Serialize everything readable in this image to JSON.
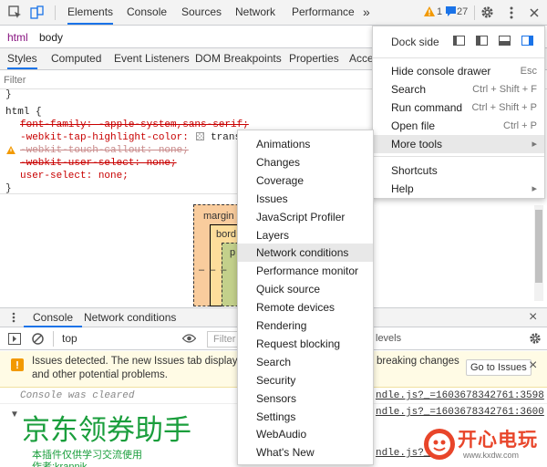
{
  "toolbar": {
    "tabs": [
      "Elements",
      "Console",
      "Sources",
      "Network",
      "Performance"
    ],
    "more_label": "»",
    "warning_count": "1",
    "message_count": "27"
  },
  "breadcrumb": [
    "html",
    "body"
  ],
  "subtabs": [
    "Styles",
    "Computed",
    "Event Listeners",
    "DOM Breakpoints",
    "Properties",
    "Acce"
  ],
  "filter": {
    "placeholder": "Filter"
  },
  "styles": {
    "brace_close_top": "}",
    "selector": "html {",
    "rules": [
      {
        "text": "font-family: -apple-system,sans-serif;",
        "struck": true
      },
      {
        "text": "-webkit-tap-highlight-color:",
        "value": "transpare",
        "struck": false,
        "swatch": true
      },
      {
        "text": "-webkit-touch-callout: none;",
        "struck": true,
        "warning": true
      },
      {
        "text": "-webkit-user-select: none;",
        "struck": true
      },
      {
        "text": "user-select: none;",
        "struck": false
      }
    ],
    "brace_close": "}"
  },
  "box_model": {
    "margin_label": "margin",
    "border_label": "bord",
    "padding_label": "p",
    "dash": "–"
  },
  "drawer": {
    "tabs": [
      "Console",
      "Network conditions"
    ],
    "close_glyph": "×"
  },
  "console": {
    "context": "top",
    "filter_placeholder": "Filter",
    "levels_label": "levels"
  },
  "issues": {
    "message_line1": "Issues detected. The new Issues tab displays in",
    "message_tail": "breaking changes",
    "message_line2": "and other potential problems.",
    "button": "Go to Issues"
  },
  "log": {
    "cleared": "Console was cleared",
    "source1": "ndle.js?_=1603678342761:3598",
    "source2": "ndle.js?_=1603678342761:3600",
    "source3": "ndle.js?_=",
    "big_title": "京东领券助手",
    "line1": "本插件仅供学习交流使用",
    "line2": "作者:krannik"
  },
  "main_menu": {
    "dock_side_label": "Dock side",
    "items": [
      {
        "label": "Hide console drawer",
        "shortcut": "Esc"
      },
      {
        "label": "Search",
        "shortcut": "Ctrl + Shift + F"
      },
      {
        "label": "Run command",
        "shortcut": "Ctrl + Shift + P"
      },
      {
        "label": "Open file",
        "shortcut": "Ctrl + P"
      },
      {
        "label": "More tools",
        "shortcut": "▸",
        "highlighted": true
      },
      {
        "label": "Shortcuts",
        "shortcut": ""
      },
      {
        "label": "Help",
        "shortcut": "▸"
      }
    ]
  },
  "more_tools_menu": {
    "items": [
      "Animations",
      "Changes",
      "Coverage",
      "Issues",
      "JavaScript Profiler",
      "Layers",
      "Network conditions",
      "Performance monitor",
      "Quick source",
      "Remote devices",
      "Rendering",
      "Request blocking",
      "Search",
      "Security",
      "Sensors",
      "Settings",
      "WebAudio",
      "What's New"
    ],
    "highlighted": "Network conditions"
  },
  "watermark": {
    "text": "开心电玩",
    "url": "www.kxdw.com"
  },
  "colors": {
    "accent": "#1a73e8",
    "margin_fill": "#f9cc9d",
    "border_fill": "#fddd9b",
    "padding_fill": "#c3d08b",
    "big_title_color": "#1a9e3c",
    "warning": "#f29900"
  }
}
